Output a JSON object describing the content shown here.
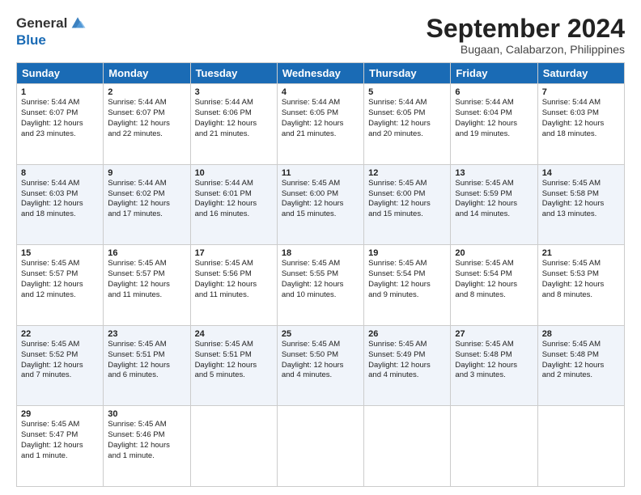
{
  "logo": {
    "general": "General",
    "blue": "Blue"
  },
  "title": "September 2024",
  "location": "Bugaan, Calabarzon, Philippines",
  "headers": [
    "Sunday",
    "Monday",
    "Tuesday",
    "Wednesday",
    "Thursday",
    "Friday",
    "Saturday"
  ],
  "weeks": [
    [
      {
        "day": "1",
        "lines": [
          "Sunrise: 5:44 AM",
          "Sunset: 6:07 PM",
          "Daylight: 12 hours",
          "and 23 minutes."
        ]
      },
      {
        "day": "2",
        "lines": [
          "Sunrise: 5:44 AM",
          "Sunset: 6:07 PM",
          "Daylight: 12 hours",
          "and 22 minutes."
        ]
      },
      {
        "day": "3",
        "lines": [
          "Sunrise: 5:44 AM",
          "Sunset: 6:06 PM",
          "Daylight: 12 hours",
          "and 21 minutes."
        ]
      },
      {
        "day": "4",
        "lines": [
          "Sunrise: 5:44 AM",
          "Sunset: 6:05 PM",
          "Daylight: 12 hours",
          "and 21 minutes."
        ]
      },
      {
        "day": "5",
        "lines": [
          "Sunrise: 5:44 AM",
          "Sunset: 6:05 PM",
          "Daylight: 12 hours",
          "and 20 minutes."
        ]
      },
      {
        "day": "6",
        "lines": [
          "Sunrise: 5:44 AM",
          "Sunset: 6:04 PM",
          "Daylight: 12 hours",
          "and 19 minutes."
        ]
      },
      {
        "day": "7",
        "lines": [
          "Sunrise: 5:44 AM",
          "Sunset: 6:03 PM",
          "Daylight: 12 hours",
          "and 18 minutes."
        ]
      }
    ],
    [
      {
        "day": "8",
        "lines": [
          "Sunrise: 5:44 AM",
          "Sunset: 6:03 PM",
          "Daylight: 12 hours",
          "and 18 minutes."
        ]
      },
      {
        "day": "9",
        "lines": [
          "Sunrise: 5:44 AM",
          "Sunset: 6:02 PM",
          "Daylight: 12 hours",
          "and 17 minutes."
        ]
      },
      {
        "day": "10",
        "lines": [
          "Sunrise: 5:44 AM",
          "Sunset: 6:01 PM",
          "Daylight: 12 hours",
          "and 16 minutes."
        ]
      },
      {
        "day": "11",
        "lines": [
          "Sunrise: 5:45 AM",
          "Sunset: 6:00 PM",
          "Daylight: 12 hours",
          "and 15 minutes."
        ]
      },
      {
        "day": "12",
        "lines": [
          "Sunrise: 5:45 AM",
          "Sunset: 6:00 PM",
          "Daylight: 12 hours",
          "and 15 minutes."
        ]
      },
      {
        "day": "13",
        "lines": [
          "Sunrise: 5:45 AM",
          "Sunset: 5:59 PM",
          "Daylight: 12 hours",
          "and 14 minutes."
        ]
      },
      {
        "day": "14",
        "lines": [
          "Sunrise: 5:45 AM",
          "Sunset: 5:58 PM",
          "Daylight: 12 hours",
          "and 13 minutes."
        ]
      }
    ],
    [
      {
        "day": "15",
        "lines": [
          "Sunrise: 5:45 AM",
          "Sunset: 5:57 PM",
          "Daylight: 12 hours",
          "and 12 minutes."
        ]
      },
      {
        "day": "16",
        "lines": [
          "Sunrise: 5:45 AM",
          "Sunset: 5:57 PM",
          "Daylight: 12 hours",
          "and 11 minutes."
        ]
      },
      {
        "day": "17",
        "lines": [
          "Sunrise: 5:45 AM",
          "Sunset: 5:56 PM",
          "Daylight: 12 hours",
          "and 11 minutes."
        ]
      },
      {
        "day": "18",
        "lines": [
          "Sunrise: 5:45 AM",
          "Sunset: 5:55 PM",
          "Daylight: 12 hours",
          "and 10 minutes."
        ]
      },
      {
        "day": "19",
        "lines": [
          "Sunrise: 5:45 AM",
          "Sunset: 5:54 PM",
          "Daylight: 12 hours",
          "and 9 minutes."
        ]
      },
      {
        "day": "20",
        "lines": [
          "Sunrise: 5:45 AM",
          "Sunset: 5:54 PM",
          "Daylight: 12 hours",
          "and 8 minutes."
        ]
      },
      {
        "day": "21",
        "lines": [
          "Sunrise: 5:45 AM",
          "Sunset: 5:53 PM",
          "Daylight: 12 hours",
          "and 8 minutes."
        ]
      }
    ],
    [
      {
        "day": "22",
        "lines": [
          "Sunrise: 5:45 AM",
          "Sunset: 5:52 PM",
          "Daylight: 12 hours",
          "and 7 minutes."
        ]
      },
      {
        "day": "23",
        "lines": [
          "Sunrise: 5:45 AM",
          "Sunset: 5:51 PM",
          "Daylight: 12 hours",
          "and 6 minutes."
        ]
      },
      {
        "day": "24",
        "lines": [
          "Sunrise: 5:45 AM",
          "Sunset: 5:51 PM",
          "Daylight: 12 hours",
          "and 5 minutes."
        ]
      },
      {
        "day": "25",
        "lines": [
          "Sunrise: 5:45 AM",
          "Sunset: 5:50 PM",
          "Daylight: 12 hours",
          "and 4 minutes."
        ]
      },
      {
        "day": "26",
        "lines": [
          "Sunrise: 5:45 AM",
          "Sunset: 5:49 PM",
          "Daylight: 12 hours",
          "and 4 minutes."
        ]
      },
      {
        "day": "27",
        "lines": [
          "Sunrise: 5:45 AM",
          "Sunset: 5:48 PM",
          "Daylight: 12 hours",
          "and 3 minutes."
        ]
      },
      {
        "day": "28",
        "lines": [
          "Sunrise: 5:45 AM",
          "Sunset: 5:48 PM",
          "Daylight: 12 hours",
          "and 2 minutes."
        ]
      }
    ],
    [
      {
        "day": "29",
        "lines": [
          "Sunrise: 5:45 AM",
          "Sunset: 5:47 PM",
          "Daylight: 12 hours",
          "and 1 minute."
        ]
      },
      {
        "day": "30",
        "lines": [
          "Sunrise: 5:45 AM",
          "Sunset: 5:46 PM",
          "Daylight: 12 hours",
          "and 1 minute."
        ]
      },
      {
        "day": "",
        "lines": []
      },
      {
        "day": "",
        "lines": []
      },
      {
        "day": "",
        "lines": []
      },
      {
        "day": "",
        "lines": []
      },
      {
        "day": "",
        "lines": []
      }
    ]
  ]
}
